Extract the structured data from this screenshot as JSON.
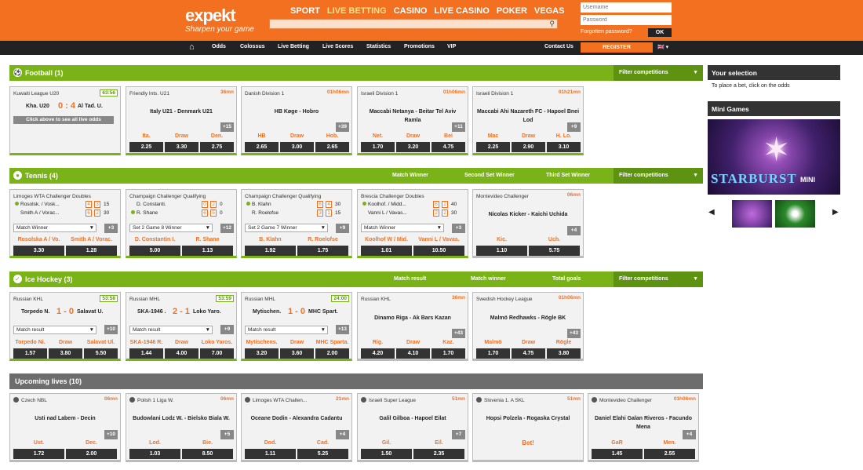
{
  "header": {
    "logo": "expekt",
    "tagline": "Sharpen your game",
    "nav": [
      "SPORT",
      "LIVE BETTING",
      "CASINO",
      "LIVE CASINO",
      "POKER",
      "VEGAS"
    ],
    "username_placeholder": "Username",
    "password_placeholder": "Password",
    "forgot": "Forgotten password?",
    "ok": "OK"
  },
  "subnav": {
    "items": [
      "Odds",
      "Colossus",
      "Live Betting",
      "Live Scores",
      "Statistics",
      "Promotions",
      "VIP"
    ],
    "contact": "Contact Us",
    "register": "REGISTER",
    "lang": "🇬🇧 ▾"
  },
  "football": {
    "title": "Football (1)",
    "filter": "Filter competitions",
    "cards": [
      {
        "league": "Kuwaiti League U20",
        "time": "63:56",
        "home": "Kha. U20",
        "score": "0 : 4",
        "away": "Al Tad. U.",
        "cta": "Click above to see all live odds"
      },
      {
        "league": "Friendly Ints. U21",
        "time": "36mn",
        "match": "Italy U21 - Denmark U21",
        "more": "+15",
        "labels": [
          "Ita.",
          "Draw",
          "Den."
        ],
        "odds": [
          "2.25",
          "3.30",
          "2.75"
        ]
      },
      {
        "league": "Danish Division 1",
        "time": "01h06mn",
        "match": "HB Køge - Hobro",
        "more": "+39",
        "labels": [
          "HB",
          "Draw",
          "Hob."
        ],
        "odds": [
          "2.65",
          "3.00",
          "2.65"
        ]
      },
      {
        "league": "Israeli Division 1",
        "time": "01h06mn",
        "match": "Maccabi Netanya - Beitar Tel Aviv Ramla",
        "more": "+11",
        "labels": [
          "Net.",
          "Draw",
          "Bei"
        ],
        "odds": [
          "1.70",
          "3.20",
          "4.75"
        ]
      },
      {
        "league": "Israeli Division 1",
        "time": "01h21mn",
        "match": "Maccabi Ahi Nazareth FC - Hapoel Bnei Lod",
        "more": "+9",
        "labels": [
          "Mac",
          "Draw",
          "H. Lo."
        ],
        "odds": [
          "2.25",
          "2.90",
          "3.10"
        ]
      }
    ]
  },
  "tennis": {
    "title": "Tennis (4)",
    "cols": [
      "Match Winner",
      "Second Set Winner",
      "Third Set Winner"
    ],
    "filter": "Filter competitions",
    "cards": [
      {
        "league": "Limoges WTA Challenger Doubles",
        "p1": "Rosolsk. / Vosk...",
        "p2": "Smith A / Vorac...",
        "s1": [
          "4",
          "3",
          "15"
        ],
        "s2": [
          "6",
          "2",
          "30"
        ],
        "market": "Match Winner",
        "more": "+3",
        "labels": [
          "Rosolska A / Vo.",
          "Smith A / Vorac."
        ],
        "odds": [
          "3.30",
          "1.28"
        ]
      },
      {
        "league": "Champaign Challenger Qualifying",
        "p1": "D. Constanti.",
        "p2": "R. Shane",
        "s1": [
          "0",
          "2",
          "0"
        ],
        "s2": [
          "6",
          "5",
          "0"
        ],
        "market": "Set 2 Game 8 Winner",
        "more": "+12",
        "labels": [
          "D. Constantin I.",
          "R. Shane"
        ],
        "odds": [
          "5.00",
          "1.13"
        ]
      },
      {
        "league": "Champaign Challenger Qualifying",
        "p1": "B. Klahn",
        "p2": "R. Roelofse",
        "s1": [
          "6",
          "4",
          "30"
        ],
        "s2": [
          "3",
          "1",
          "15"
        ],
        "market": "Set 2 Game 7 Winner",
        "more": "+9",
        "labels": [
          "B. Klahn",
          "R. Roelofse"
        ],
        "odds": [
          "1.92",
          "1.75"
        ]
      },
      {
        "league": "Brescia Challenger Doubles",
        "p1": "Koolhof. / Midd...",
        "p2": "Vanni L / Vavas...",
        "s1": [
          "6",
          "2",
          "40"
        ],
        "s2": [
          "2",
          "2",
          "30"
        ],
        "market": "Match Winner",
        "more": "+3",
        "labels": [
          "Koolhof W / Mid.",
          "Vanni L / Vavas."
        ],
        "odds": [
          "1.01",
          "10.50"
        ]
      },
      {
        "league": "Montevideo Challenger",
        "time": "06mn",
        "match": "Nicolas Kicker - Kaichi Uchida",
        "more": "+4",
        "labels": [
          "Kic.",
          "Uch."
        ],
        "odds": [
          "1.10",
          "5.75"
        ]
      }
    ]
  },
  "hockey": {
    "title": "Ice Hockey (3)",
    "cols": [
      "Match result",
      "Match winner",
      "Total goals"
    ],
    "filter": "Filter competitions",
    "cards": [
      {
        "league": "Russian KHL",
        "time": "53:58",
        "home": "Torpedo N.",
        "score": "1 - 0",
        "away": "Salavat U.",
        "market": "Match result",
        "more": "+10",
        "labels": [
          "Torpedo Ni.",
          "Draw",
          "Salavat Ul."
        ],
        "odds": [
          "1.57",
          "3.80",
          "5.50"
        ]
      },
      {
        "league": "Russian MHL",
        "time": "53:59",
        "home": "SKA-1946 .",
        "score": "2 - 1",
        "away": "Loko Yaro.",
        "market": "Match result",
        "more": "+9",
        "labels": [
          "SKA-1946 R.",
          "Draw",
          "Loko Yaros."
        ],
        "odds": [
          "1.44",
          "4.00",
          "7.00"
        ]
      },
      {
        "league": "Russian MHL",
        "time": "24:00",
        "home": "Mytischen.",
        "score": "1 - 0",
        "away": "MHC Spart.",
        "market": "Match result",
        "more": "+13",
        "labels": [
          "Mytischens.",
          "Draw",
          "MHC Sparta."
        ],
        "odds": [
          "3.20",
          "3.60",
          "2.00"
        ]
      },
      {
        "league": "Russian KHL",
        "time": "36mn",
        "match": "Dinamo Riga - Ak Bars Kazan",
        "more": "+43",
        "labels": [
          "Rig.",
          "Draw",
          "Kaz."
        ],
        "odds": [
          "4.20",
          "4.10",
          "1.70"
        ]
      },
      {
        "league": "Swedish Hockey League",
        "time": "01h06mn",
        "match": "Malmö Redhawks - Rögle BK",
        "more": "+43",
        "labels": [
          "Malmö",
          "Draw",
          "Rögle"
        ],
        "odds": [
          "1.70",
          "4.75",
          "3.80"
        ]
      }
    ]
  },
  "upcoming": {
    "title": "Upcoming lives (10)",
    "cards": [
      {
        "league": "Czech NBL",
        "time": "06mn",
        "match": "Usti nad Labem - Decin",
        "more": "+10",
        "labels": [
          "Ust.",
          "Dec."
        ],
        "odds": [
          "1.72",
          "2.00"
        ]
      },
      {
        "league": "Polish 1 Liga W.",
        "time": "06mn",
        "match": "Budowlani Lodz W. - Bielsko Biala W.",
        "more": "+5",
        "labels": [
          "Lod.",
          "Bie."
        ],
        "odds": [
          "1.03",
          "8.50"
        ]
      },
      {
        "league": "Limoges WTA Challen...",
        "time": "21mn",
        "match": "Oceane Dodin - Alexandra Cadantu",
        "more": "+4",
        "labels": [
          "Dod.",
          "Cad."
        ],
        "odds": [
          "1.11",
          "5.25"
        ]
      },
      {
        "league": "Israeli Super League",
        "time": "51mn",
        "match": "Galil Gilboa - Hapoel Eilat",
        "more": "+7",
        "labels": [
          "Gil.",
          "Eil."
        ],
        "odds": [
          "1.50",
          "2.35"
        ]
      },
      {
        "league": "Slovenia 1. A SKL",
        "time": "51mn",
        "match": "Hopsi Polzela - Rogaska Crystal",
        "bet": "Bet!"
      },
      {
        "league": "Montevideo Challenger",
        "time": "01h06mn",
        "match": "Daniel Elahi Galan Riveros - Facundo Mena",
        "more": "+4",
        "labels": [
          "GaR",
          "Men."
        ],
        "odds": [
          "1.45",
          "2.55"
        ]
      }
    ]
  },
  "sidebar": {
    "selection_title": "Your selection",
    "selection_hint": "To place a bet, click on the odds",
    "mini_title": "Mini Games",
    "mini_game": "STARBURST",
    "mini_sub": "MINI"
  }
}
